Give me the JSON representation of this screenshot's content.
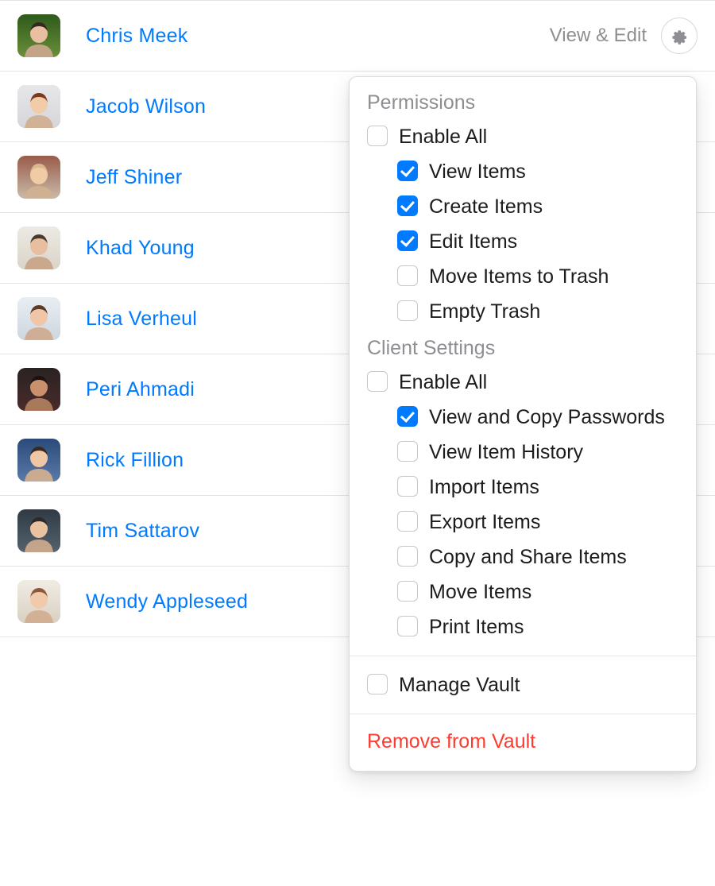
{
  "users": [
    {
      "name": "Chris Meek",
      "role": "View & Edit",
      "avatar_bg1": "#2d5a1a",
      "avatar_bg2": "#6b8f3a",
      "face": "#e8bfa0",
      "hair": "#35281c"
    },
    {
      "name": "Jacob Wilson",
      "role": "",
      "avatar_bg1": "#e7e7ea",
      "avatar_bg2": "#d6d6da",
      "face": "#f2cba9",
      "hair": "#7b3a1e"
    },
    {
      "name": "Jeff Shiner",
      "role": "",
      "avatar_bg1": "#9a5a4a",
      "avatar_bg2": "#c9bba9",
      "face": "#efcba6",
      "hair": "#d9b98a"
    },
    {
      "name": "Khad Young",
      "role": "",
      "avatar_bg1": "#eceae4",
      "avatar_bg2": "#d9d4c8",
      "face": "#e7bfa0",
      "hair": "#4a3a2a"
    },
    {
      "name": "Lisa Verheul",
      "role": "",
      "avatar_bg1": "#e9eef3",
      "avatar_bg2": "#cdd6de",
      "face": "#efc6a8",
      "hair": "#5d3b27"
    },
    {
      "name": "Peri Ahmadi",
      "role": "",
      "avatar_bg1": "#2a2222",
      "avatar_bg2": "#4a2b2b",
      "face": "#c8906b",
      "hair": "#1a1212"
    },
    {
      "name": "Rick Fillion",
      "role": "",
      "avatar_bg1": "#2a4a7a",
      "avatar_bg2": "#5a7aa8",
      "face": "#efc7a6",
      "hair": "#3a2a1e"
    },
    {
      "name": "Tim Sattarov",
      "role": "",
      "avatar_bg1": "#2f3a44",
      "avatar_bg2": "#55626e",
      "face": "#e9c2a0",
      "hair": "#2b2b2b"
    },
    {
      "name": "Wendy Appleseed",
      "role": "",
      "avatar_bg1": "#f0ece5",
      "avatar_bg2": "#d9d0c2",
      "face": "#f2c9aa",
      "hair": "#8a5a3a"
    }
  ],
  "popover": {
    "sections": [
      {
        "title": "Permissions",
        "enable_all": {
          "label": "Enable All",
          "checked": false
        },
        "items": [
          {
            "label": "View Items",
            "checked": true
          },
          {
            "label": "Create Items",
            "checked": true
          },
          {
            "label": "Edit Items",
            "checked": true
          },
          {
            "label": "Move Items to Trash",
            "checked": false
          },
          {
            "label": "Empty Trash",
            "checked": false
          }
        ]
      },
      {
        "title": "Client Settings",
        "enable_all": {
          "label": "Enable All",
          "checked": false
        },
        "items": [
          {
            "label": "View and Copy Passwords",
            "checked": true
          },
          {
            "label": "View Item History",
            "checked": false
          },
          {
            "label": "Import Items",
            "checked": false
          },
          {
            "label": "Export Items",
            "checked": false
          },
          {
            "label": "Copy and Share Items",
            "checked": false
          },
          {
            "label": "Move Items",
            "checked": false
          },
          {
            "label": "Print Items",
            "checked": false
          }
        ]
      }
    ],
    "manage_vault": {
      "label": "Manage Vault",
      "checked": false
    },
    "remove_label": "Remove from Vault"
  }
}
